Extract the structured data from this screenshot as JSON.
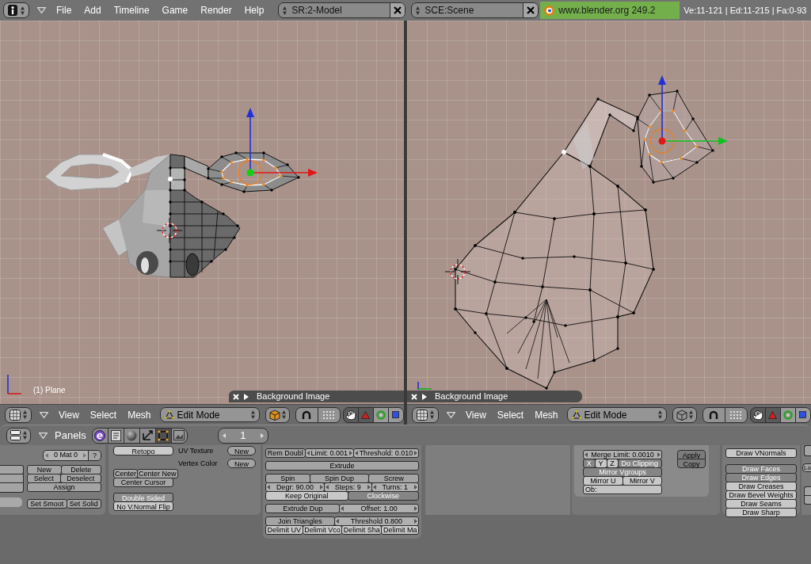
{
  "top_bar": {
    "menus": [
      "File",
      "Add",
      "Timeline",
      "Game",
      "Render",
      "Help"
    ],
    "screen": "SR:2-Model",
    "scene": "SCE:Scene",
    "version": "www.blender.org 249.2",
    "stats": "Ve:11-121 | Ed:11-215 | Fa:0-93"
  },
  "viewports": [
    {
      "object_label": "(1) Plane",
      "panel_title": "Background Image",
      "menus": [
        "View",
        "Select",
        "Mesh"
      ],
      "mode": "Edit Mode",
      "manipulators": [
        {
          "kind": "hand",
          "selected": true
        },
        {
          "kind": "translate",
          "selected": true
        },
        {
          "kind": "rotate",
          "selected": false
        },
        {
          "kind": "scale",
          "selected": false
        }
      ]
    },
    {
      "panel_title": "Background Image",
      "menus": [
        "View",
        "Select",
        "Mesh"
      ],
      "mode": "Edit Mode",
      "manipulators": [
        {
          "kind": "hand",
          "selected": true
        },
        {
          "kind": "translate",
          "selected": true
        },
        {
          "kind": "rotate",
          "selected": false
        },
        {
          "kind": "scale",
          "selected": false
        }
      ]
    }
  ],
  "buttons_window": {
    "title": "Panels",
    "contexts": [
      {
        "kind": "logic",
        "selected": false
      },
      {
        "kind": "script",
        "selected": false
      },
      {
        "kind": "shading",
        "selected": false
      },
      {
        "kind": "object",
        "selected": false
      },
      {
        "kind": "editing",
        "selected": true
      },
      {
        "kind": "scene",
        "selected": false
      }
    ],
    "frame": "1",
    "link_panel": {
      "material": "0 Mat 0",
      "help": "?",
      "groups": [
        [
          [
            {
              "kind": "button",
              "label": "New"
            },
            {
              "kind": "button",
              "label": "Delete"
            }
          ],
          [
            {
              "kind": "button",
              "label": "Select"
            },
            {
              "kind": "button",
              "label": "Deselect"
            }
          ],
          [
            {
              "kind": "button",
              "label": "Assign"
            }
          ]
        ],
        [
          [
            {
              "kind": "button",
              "label": "Set Smoot"
            },
            {
              "kind": "button",
              "label": "Set Solid"
            }
          ]
        ]
      ]
    },
    "mesh_panel": {
      "retopo": {
        "label": "Retopo",
        "on": false
      },
      "layers": [
        {
          "label": "UV Texture",
          "button": "New"
        },
        {
          "label": "Vertex Color",
          "button": "New"
        }
      ],
      "center": [
        [
          {
            "kind": "button",
            "label": "Center"
          },
          {
            "kind": "button",
            "label": "Center New"
          }
        ],
        [
          {
            "kind": "button",
            "label": "Center Cursor"
          }
        ]
      ],
      "toggles": [
        {
          "label": "Double Sided",
          "on": true
        },
        {
          "label": "No V.Normal Flip",
          "on": false
        }
      ]
    },
    "tools_panel": {
      "groups": [
        [
          [
            {
              "kind": "button",
              "label": "Rem Doubl"
            },
            {
              "kind": "number",
              "label": "Limit: 0.001"
            },
            {
              "kind": "number",
              "label": "Threshold: 0.010"
            }
          ]
        ],
        [
          [
            {
              "kind": "button",
              "label": "Extrude"
            }
          ]
        ],
        [
          [
            {
              "kind": "button",
              "label": "Spin"
            },
            {
              "kind": "button",
              "label": "Spin Dup"
            },
            {
              "kind": "button",
              "label": "Screw"
            }
          ],
          [
            {
              "kind": "number",
              "label": "Degr: 90.00"
            },
            {
              "kind": "number",
              "label": "Steps: 9"
            },
            {
              "kind": "number",
              "label": "Turns: 1"
            }
          ],
          [
            {
              "kind": "toggle",
              "label": "Keep Original",
              "on": false
            },
            {
              "kind": "toggle",
              "label": "Clockwise",
              "on": true
            }
          ]
        ],
        [
          [
            {
              "kind": "button",
              "label": "Extrude Dup"
            },
            {
              "kind": "number",
              "label": "Offset: 1.00"
            }
          ]
        ],
        [
          [
            {
              "kind": "button",
              "label": "Join Triangles"
            },
            {
              "kind": "number",
              "label": "Threshold 0.800"
            }
          ],
          [
            {
              "kind": "toggle",
              "label": "Delimit UV",
              "on": false
            },
            {
              "kind": "toggle",
              "label": "Delimit Vco",
              "on": false
            },
            {
              "kind": "toggle",
              "label": "Delimit Sha",
              "on": false
            },
            {
              "kind": "toggle",
              "label": "Delimit Ma",
              "on": false
            }
          ]
        ]
      ]
    },
    "mirror_panel": {
      "groups": [
        [
          [
            {
              "kind": "number",
              "label": "Merge Limit: 0.0010"
            }
          ],
          [
            {
              "kind": "toggle",
              "label": "X",
              "on": true
            },
            {
              "kind": "toggle",
              "label": "Y",
              "on": false
            },
            {
              "kind": "toggle",
              "label": "Z",
              "on": false
            },
            {
              "kind": "toggle",
              "label": "Do Clipping",
              "on": true
            }
          ],
          [
            {
              "kind": "toggle",
              "label": "Mirror Vgroups",
              "on": true
            }
          ],
          [
            {
              "kind": "toggle",
              "label": "Mirror U",
              "on": false
            },
            {
              "kind": "toggle",
              "label": "Mirror V",
              "on": false
            }
          ],
          [
            {
              "kind": "field",
              "label": "Ob:"
            }
          ]
        ]
      ],
      "actions": [
        "Apply",
        "Copy"
      ]
    },
    "draw_panel": {
      "groups": [
        [
          [
            {
              "kind": "toggle",
              "label": "Draw VNormals",
              "on": false
            }
          ]
        ],
        [
          [
            {
              "kind": "toggle",
              "label": "Draw Faces",
              "on": true
            }
          ],
          [
            {
              "kind": "toggle",
              "label": "Draw Edges",
              "on": true
            }
          ],
          [
            {
              "kind": "toggle",
              "label": "Draw Creases",
              "on": false
            }
          ],
          [
            {
              "kind": "toggle",
              "label": "Draw Bevel Weights",
              "on": false
            }
          ],
          [
            {
              "kind": "toggle",
              "label": "Draw Seams",
              "on": false
            }
          ],
          [
            {
              "kind": "toggle",
              "label": "Draw Sharp",
              "on": false
            }
          ]
        ]
      ]
    },
    "edge_panel": {
      "button": "Lo"
    }
  }
}
